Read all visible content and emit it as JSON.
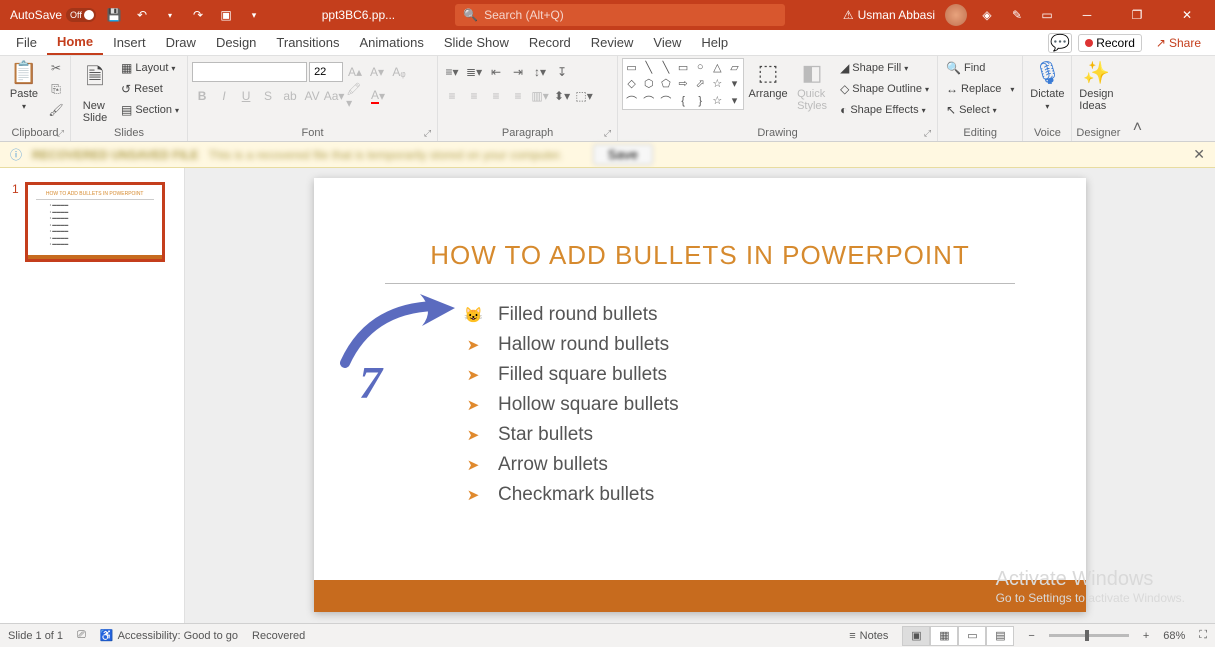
{
  "titlebar": {
    "autosave_label": "AutoSave",
    "autosave_state": "Off",
    "filename": "ppt3BC6.pp...",
    "search_placeholder": "Search (Alt+Q)",
    "user_name": "Usman Abbasi"
  },
  "menu": {
    "tabs": [
      "File",
      "Home",
      "Insert",
      "Draw",
      "Design",
      "Transitions",
      "Animations",
      "Slide Show",
      "Record",
      "Review",
      "View",
      "Help"
    ],
    "active": "Home",
    "record_label": "Record",
    "share_label": "Share"
  },
  "ribbon": {
    "clipboard": {
      "paste": "Paste",
      "label": "Clipboard"
    },
    "slides": {
      "new_slide": "New\nSlide",
      "layout": "Layout",
      "reset": "Reset",
      "section": "Section",
      "label": "Slides"
    },
    "font": {
      "size": "22",
      "label": "Font"
    },
    "paragraph": {
      "label": "Paragraph"
    },
    "drawing": {
      "arrange": "Arrange",
      "quick_styles": "Quick\nStyles",
      "shape_fill": "Shape Fill",
      "shape_outline": "Shape Outline",
      "shape_effects": "Shape Effects",
      "label": "Drawing"
    },
    "editing": {
      "find": "Find",
      "replace": "Replace",
      "select": "Select",
      "label": "Editing"
    },
    "voice": {
      "dictate": "Dictate",
      "label": "Voice"
    },
    "designer": {
      "design_ideas": "Design\nIdeas",
      "label": "Designer"
    }
  },
  "messagebar": {
    "title": "RECOVERED UNSAVED FILE",
    "text": "This is a recovered file that is temporarily stored on your computer.",
    "save": "Save"
  },
  "slidepanel": {
    "num": "1"
  },
  "slide": {
    "title": "HOW TO ADD BULLETS IN POWERPOINT",
    "bullets": [
      {
        "icon": "cat",
        "text": "Filled round bullets"
      },
      {
        "icon": "arrow",
        "text": "Hallow round bullets"
      },
      {
        "icon": "arrow",
        "text": "Filled square bullets"
      },
      {
        "icon": "arrow",
        "text": "Hollow square bullets"
      },
      {
        "icon": "arrow",
        "text": "Star bullets"
      },
      {
        "icon": "arrow",
        "text": "Arrow bullets"
      },
      {
        "icon": "arrow",
        "text": "Checkmark bullets"
      }
    ]
  },
  "annotation": {
    "number": "7"
  },
  "watermark": {
    "line1": "Activate Windows",
    "line2": "Go to Settings to activate Windows."
  },
  "statusbar": {
    "slide_info": "Slide 1 of 1",
    "accessibility": "Accessibility: Good to go",
    "recovered": "Recovered",
    "notes": "Notes",
    "zoom": "68%"
  }
}
